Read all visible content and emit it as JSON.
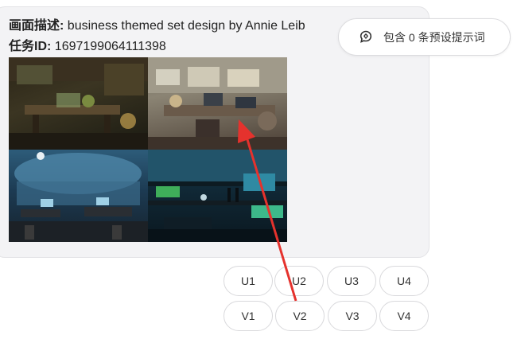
{
  "message": {
    "description_label": "画面描述:",
    "description_text": " business themed set design by Annie Leib",
    "task_label": "任务ID:",
    "task_id": " 1697199064111398",
    "image_alt": "generated image grid"
  },
  "prompt_pill": {
    "label": "包含 0 条预设提示词",
    "icon": "brain-icon"
  },
  "buttons": {
    "upscale": [
      "U1",
      "U2",
      "U3",
      "U4"
    ],
    "variation": [
      "V1",
      "V2",
      "V3",
      "V4"
    ]
  },
  "colors": {
    "annotation_arrow": "#e5322d",
    "card_bg": "#f3f3f5"
  }
}
